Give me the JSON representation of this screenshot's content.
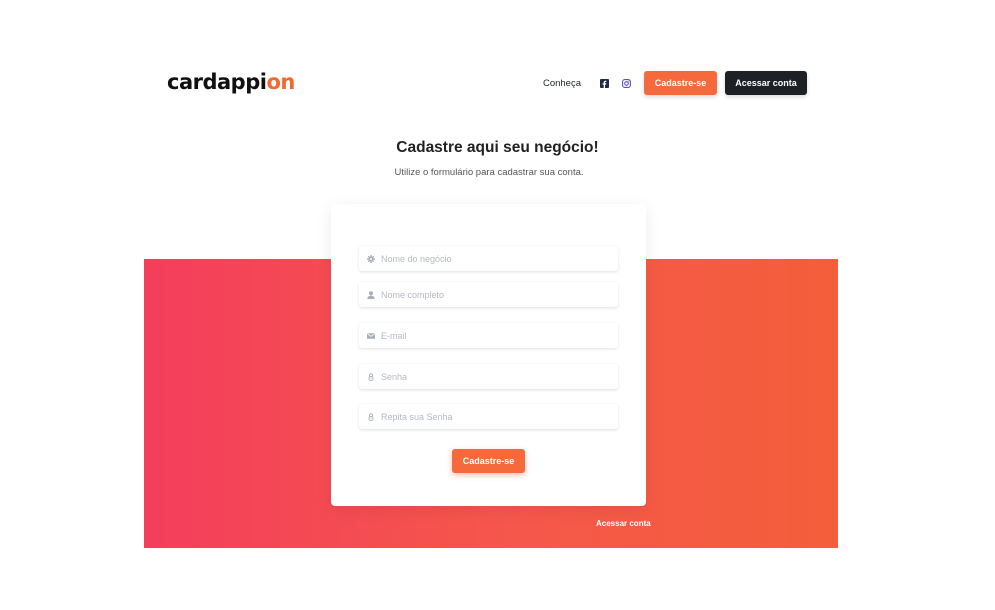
{
  "brand": {
    "logo_main": "cardappi",
    "logo_accent": "on",
    "accent_color": "#f2682f"
  },
  "nav": {
    "link": "Conheça",
    "social": [
      "facebook-icon",
      "instagram-icon"
    ],
    "signup": "Cadastre-se",
    "login": "Acessar conta"
  },
  "hero": {
    "title": "Cadastre aqui seu negócio!",
    "subtitle": "Utilize o formulário para cadastrar sua conta."
  },
  "form": {
    "fields": [
      {
        "placeholder": "Nome do negócio",
        "icon": "gear-icon"
      },
      {
        "placeholder": "Nome completo",
        "icon": "user-icon"
      },
      {
        "placeholder": "E-mail",
        "icon": "envelope-icon"
      },
      {
        "placeholder": "Senha",
        "icon": "lock-icon"
      },
      {
        "placeholder": "Repita sua Senha",
        "icon": "lock-icon"
      }
    ],
    "submit": "Cadastre-se"
  },
  "footer_link": "Acessar conta",
  "colors": {
    "primary": "#f6693c",
    "dark": "#1d2126",
    "gradient_start": "#f43e5c",
    "gradient_end": "#f45e3a"
  }
}
